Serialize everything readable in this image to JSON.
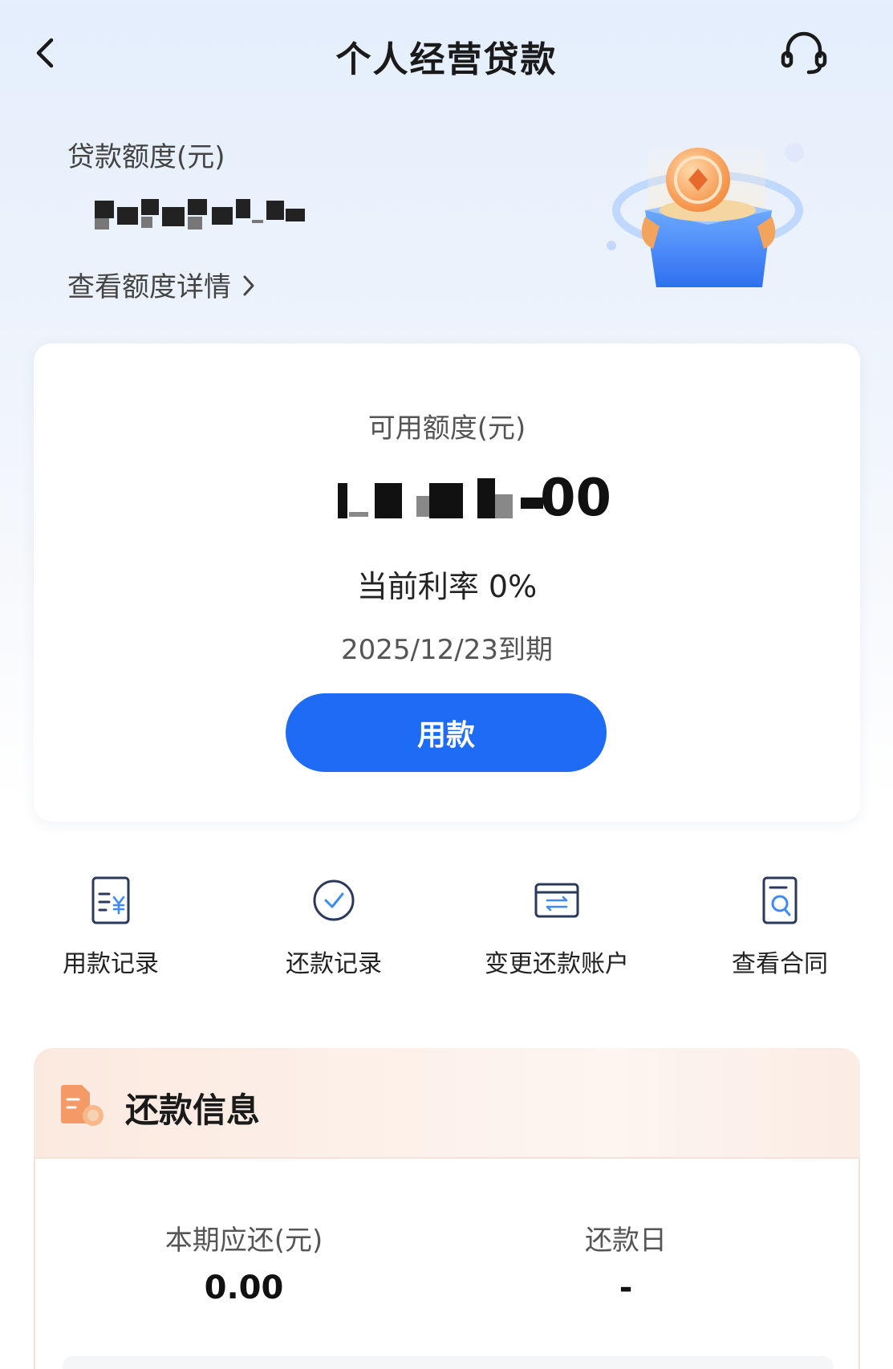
{
  "header": {
    "title": "个人经营贷款"
  },
  "limit": {
    "label": "贷款额度(元)",
    "detail_link": "查看额度详情"
  },
  "card": {
    "available_label": "可用额度(元)",
    "available_value_tail": "00",
    "rate_text": "当前利率 0%",
    "due_text": "2025/12/23到期",
    "use_button": "用款"
  },
  "actions": [
    {
      "label": "用款记录",
      "icon": "receipt-yuan-icon"
    },
    {
      "label": "还款记录",
      "icon": "check-circle-icon"
    },
    {
      "label": "变更还款账户",
      "icon": "card-transfer-icon"
    },
    {
      "label": "查看合同",
      "icon": "document-search-icon"
    }
  ],
  "repayment": {
    "title": "还款信息",
    "current_due_label": "本期应还(元)",
    "current_due_value": "0.00",
    "repay_day_label": "还款日",
    "repay_day_value": "-"
  },
  "colors": {
    "primary": "#1e6cf5",
    "accent_orange": "#f08a5a",
    "icon_navy": "#2b3a5c",
    "icon_blue": "#3d8bf7"
  }
}
